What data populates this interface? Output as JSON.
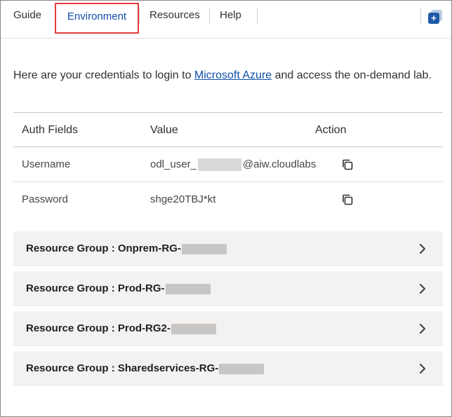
{
  "tabs": [
    {
      "label": "Guide"
    },
    {
      "label": "Environment"
    },
    {
      "label": "Resources"
    },
    {
      "label": "Help"
    }
  ],
  "intro": {
    "before": "Here are your credentials to login to ",
    "link": "Microsoft Azure",
    "after": " and access the on-demand lab."
  },
  "credentials": {
    "headers": [
      "Auth Fields",
      "Value",
      "Action"
    ],
    "rows": [
      {
        "field": "Username",
        "value_prefix": "odl_user_",
        "value_suffix": "@aiw.cloudlabs.ai"
      },
      {
        "field": "Password",
        "value": "shge20TBJ*kt"
      }
    ]
  },
  "resource_groups": [
    {
      "label": "Resource Group : Onprem-RG-"
    },
    {
      "label": "Resource Group : Prod-RG-"
    },
    {
      "label": "Resource Group : Prod-RG2-"
    },
    {
      "label": "Resource Group : Sharedservices-RG-"
    }
  ],
  "colors": {
    "active_tab": "#0f4fa8",
    "highlight_box": "#e03e3e",
    "link": "#0f4fa8",
    "group_bg": "#f3f2f1"
  },
  "icons": {
    "copy": "copy-icon",
    "chevron": "chevron-right-icon",
    "launch": "launch-icon"
  }
}
